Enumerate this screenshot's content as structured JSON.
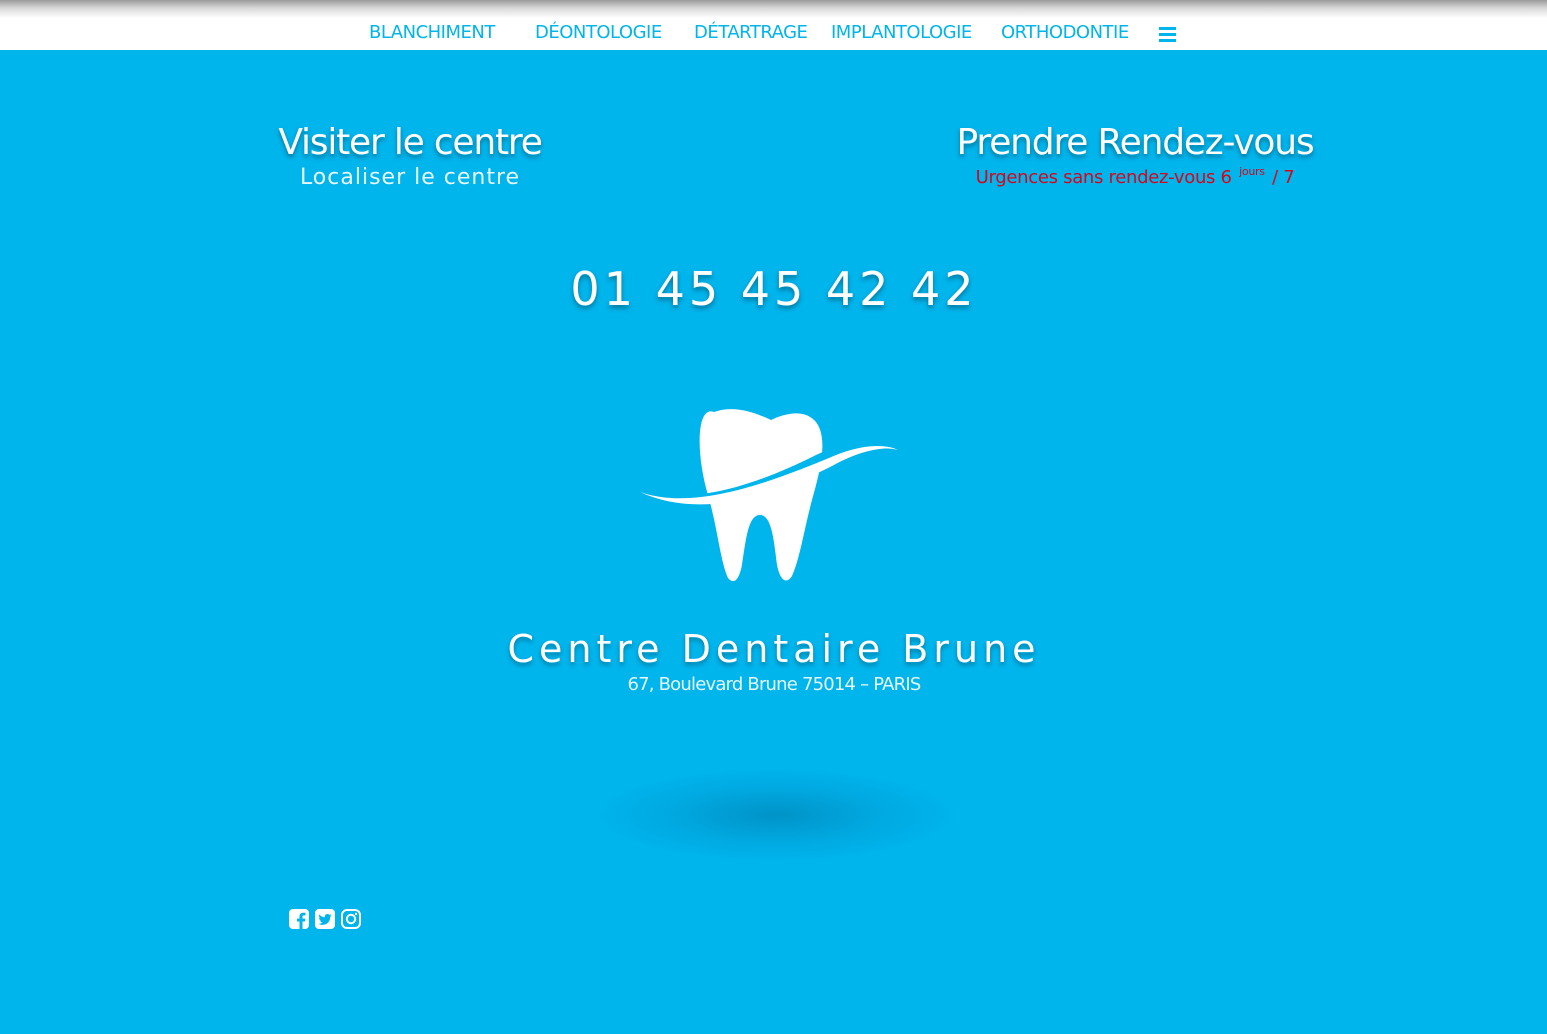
{
  "nav": {
    "items": [
      "BLANCHIMENT",
      "DÉONTOLOGIE",
      "DÉTARTRAGE",
      "IMPLANTOLOGIE",
      "ORTHODONTIE"
    ],
    "menu_icon": "hamburger-menu-icon"
  },
  "visit": {
    "title": "Visiter le centre",
    "subtitle": "Localiser le centre"
  },
  "appointment": {
    "title": "Prendre Rendez-vous",
    "urgences_prefix": "Urgences sans rendez-vous 6",
    "urgences_sup": "jours",
    "urgences_suffix": "/ 7"
  },
  "phone": "01 45 45 42 42",
  "brand": {
    "name": "Centre Dentaire Brune",
    "address": "67, Boulevard Brune 75014 – PARIS",
    "logo_icon": "tooth-logo-icon"
  },
  "social": {
    "icons": [
      "facebook-icon",
      "twitter-icon",
      "instagram-icon"
    ]
  },
  "colors": {
    "background": "#00b4ec",
    "accent": "#00b4ec",
    "urgent": "#d7061b",
    "text": "#ffffff"
  }
}
